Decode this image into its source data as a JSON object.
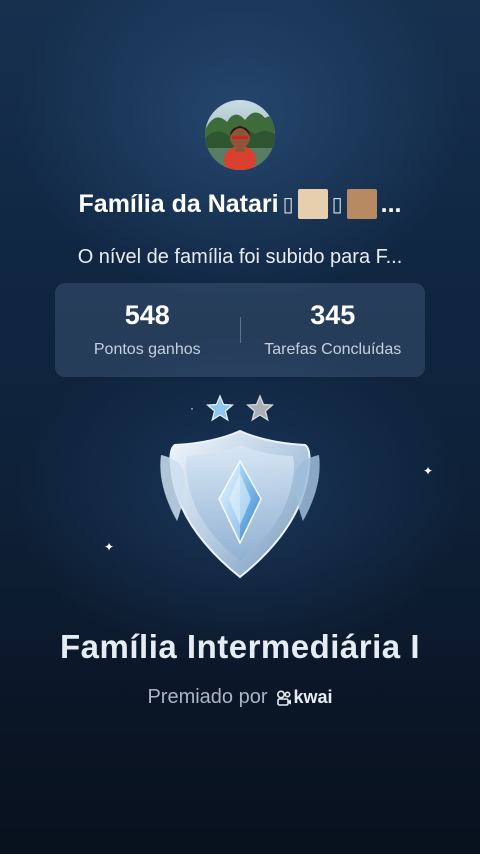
{
  "profile": {
    "family_name": "Família da Natari",
    "name_glyph": "▯",
    "swatch_colors": [
      "#e7cfae",
      "#b88a63"
    ],
    "ellipsis": "..."
  },
  "level_message": "O nível de família foi subido para F...",
  "stats": [
    {
      "value": "548",
      "label": "Pontos ganhos"
    },
    {
      "value": "345",
      "label": "Tarefas Concluídas"
    }
  ],
  "stars": {
    "earned": 1,
    "total": 2
  },
  "badge": {
    "icon": "shield-crystal-icon"
  },
  "level_title": "Família Intermediária I",
  "awarded": {
    "text": "Premiado por",
    "brand": "kwai",
    "brand_icon": "kwai-logo-icon"
  },
  "colors": {
    "background_top": "#16304f",
    "background_bottom": "#08111e",
    "star_blue": "#8fc6f2",
    "star_silver": "#a9b0b8"
  }
}
